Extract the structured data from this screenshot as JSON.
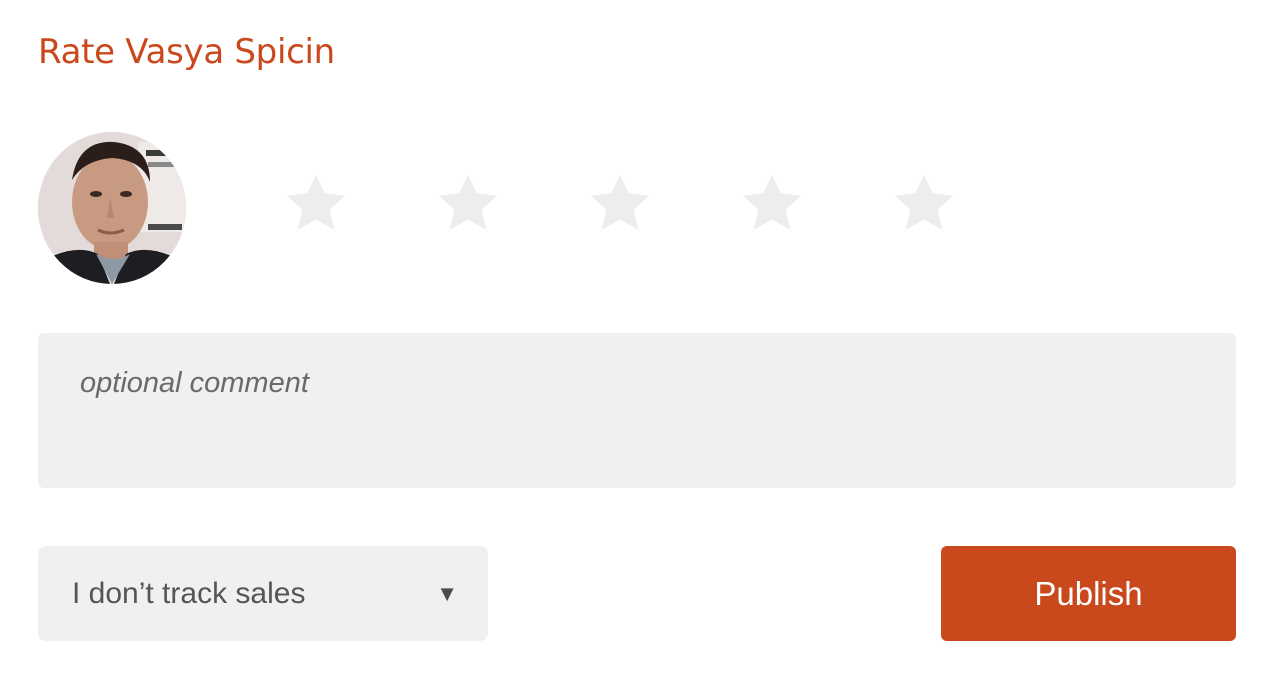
{
  "header": {
    "title": "Rate Vasya Spicin"
  },
  "avatar": {
    "icon": "person-photo"
  },
  "rating": {
    "max_stars": 5,
    "selected": 0,
    "star_icon": "star-icon",
    "empty_color": "#ededed"
  },
  "comment": {
    "placeholder": "optional comment",
    "value": ""
  },
  "sales_select": {
    "selected": "I don’t track sales",
    "arrow_icon": "caret-down-icon"
  },
  "actions": {
    "publish_label": "Publish"
  },
  "colors": {
    "accent": "#c9491c",
    "field_background": "#f0f0f0"
  }
}
